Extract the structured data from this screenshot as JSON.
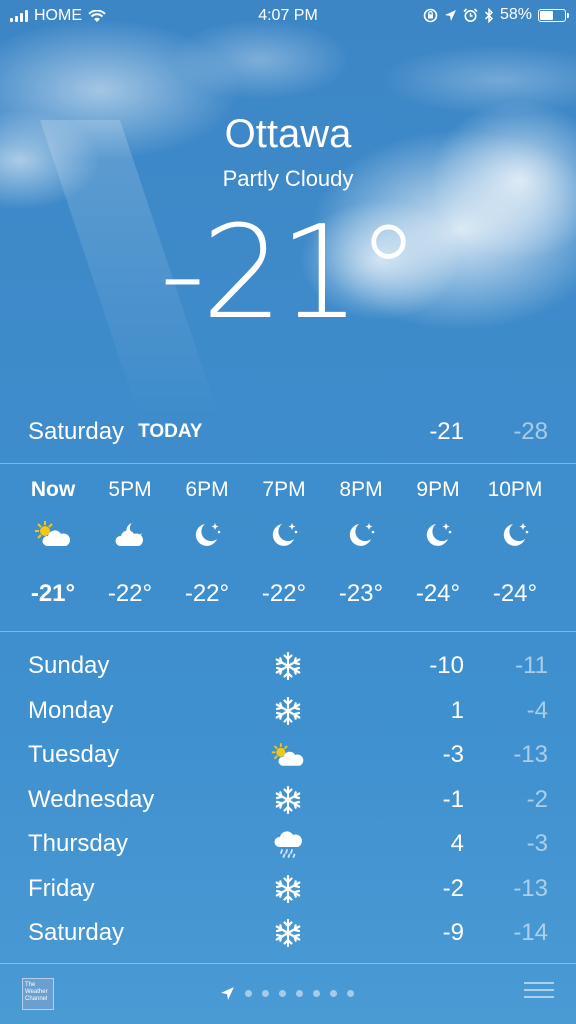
{
  "status_bar": {
    "carrier": "HOME",
    "time": "4:07 PM",
    "battery": "58%",
    "battery_level": 0.58
  },
  "location": {
    "city": "Ottawa",
    "condition": "Partly Cloudy",
    "temperature": "-21°"
  },
  "today": {
    "day": "Saturday",
    "tag": "TODAY",
    "high": "-21",
    "low": "-28"
  },
  "hourly": [
    {
      "time": "Now",
      "icon": "partly-cloudy-day-icon",
      "temp": "-21°"
    },
    {
      "time": "5PM",
      "icon": "partly-cloudy-night-icon",
      "temp": "-22°"
    },
    {
      "time": "6PM",
      "icon": "moon-stars-icon",
      "temp": "-22°"
    },
    {
      "time": "7PM",
      "icon": "moon-stars-icon",
      "temp": "-22°"
    },
    {
      "time": "8PM",
      "icon": "moon-stars-icon",
      "temp": "-23°"
    },
    {
      "time": "9PM",
      "icon": "moon-stars-icon",
      "temp": "-24°"
    },
    {
      "time": "10PM",
      "icon": "moon-stars-icon",
      "temp": "-24°"
    }
  ],
  "daily": [
    {
      "day": "Sunday",
      "icon": "snowflake-icon",
      "high": "-10",
      "low": "-11"
    },
    {
      "day": "Monday",
      "icon": "snowflake-icon",
      "high": "1",
      "low": "-4"
    },
    {
      "day": "Tuesday",
      "icon": "partly-cloudy-day-icon",
      "high": "-3",
      "low": "-13"
    },
    {
      "day": "Wednesday",
      "icon": "snowflake-icon",
      "high": "-1",
      "low": "-2"
    },
    {
      "day": "Thursday",
      "icon": "rain-cloud-icon",
      "high": "4",
      "low": "-3"
    },
    {
      "day": "Friday",
      "icon": "snowflake-icon",
      "high": "-2",
      "low": "-13"
    },
    {
      "day": "Saturday",
      "icon": "snowflake-icon",
      "high": "-9",
      "low": "-14"
    }
  ],
  "footer": {
    "logo_text": "The Weather Channel",
    "page_dots": 7
  },
  "colors": {
    "sky": "#3e8ccb",
    "sun": "#f5c518",
    "lowtemp": "rgba(255,255,255,0.55)"
  }
}
